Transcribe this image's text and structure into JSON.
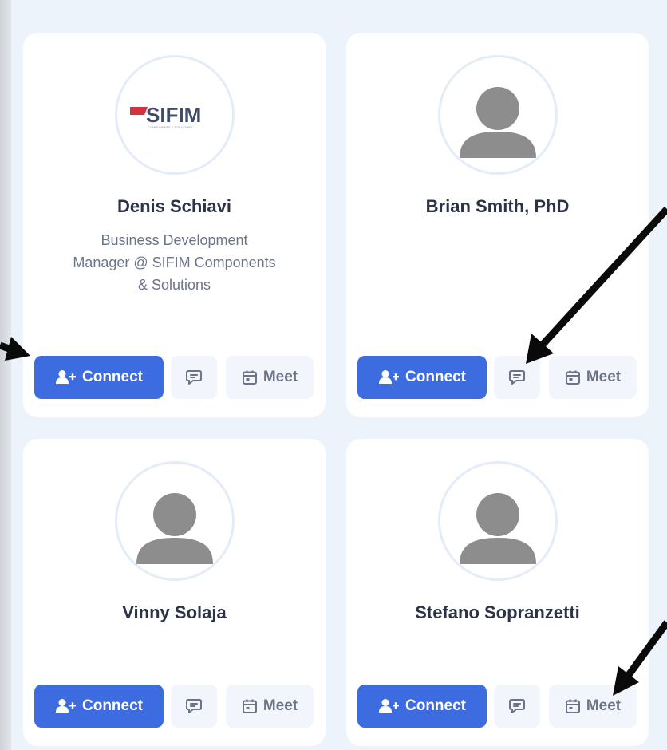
{
  "colors": {
    "primary": "#3d6ce1",
    "card_bg": "#ffffff",
    "panel_bg": "#edf3fa",
    "name_text": "#2c3346",
    "role_text": "#6c7489",
    "secondary_btn_bg": "#f2f6fc"
  },
  "actions": {
    "connect_label": "Connect",
    "meet_label": "Meet"
  },
  "cards": [
    {
      "name": "Denis Schiavi",
      "role_line1": "Business Development",
      "role_line2": "Manager @ SIFIM Components",
      "role_line3": "& Solutions",
      "avatar": "sifim-logo",
      "logo_text": "SIFIM",
      "logo_subtext": "COMPONENTS & SOLUTIONS"
    },
    {
      "name": "Brian Smith, PhD",
      "avatar": "default-user-icon"
    },
    {
      "name": "Vinny Solaja",
      "avatar": "default-user-icon"
    },
    {
      "name": "Stefano Sopranzetti",
      "avatar": "default-user-icon"
    }
  ],
  "icons": {
    "connect": "user-plus-icon",
    "message": "chat-bubble-icon",
    "meet": "calendar-icon",
    "annotation": "arrow-annotation"
  }
}
